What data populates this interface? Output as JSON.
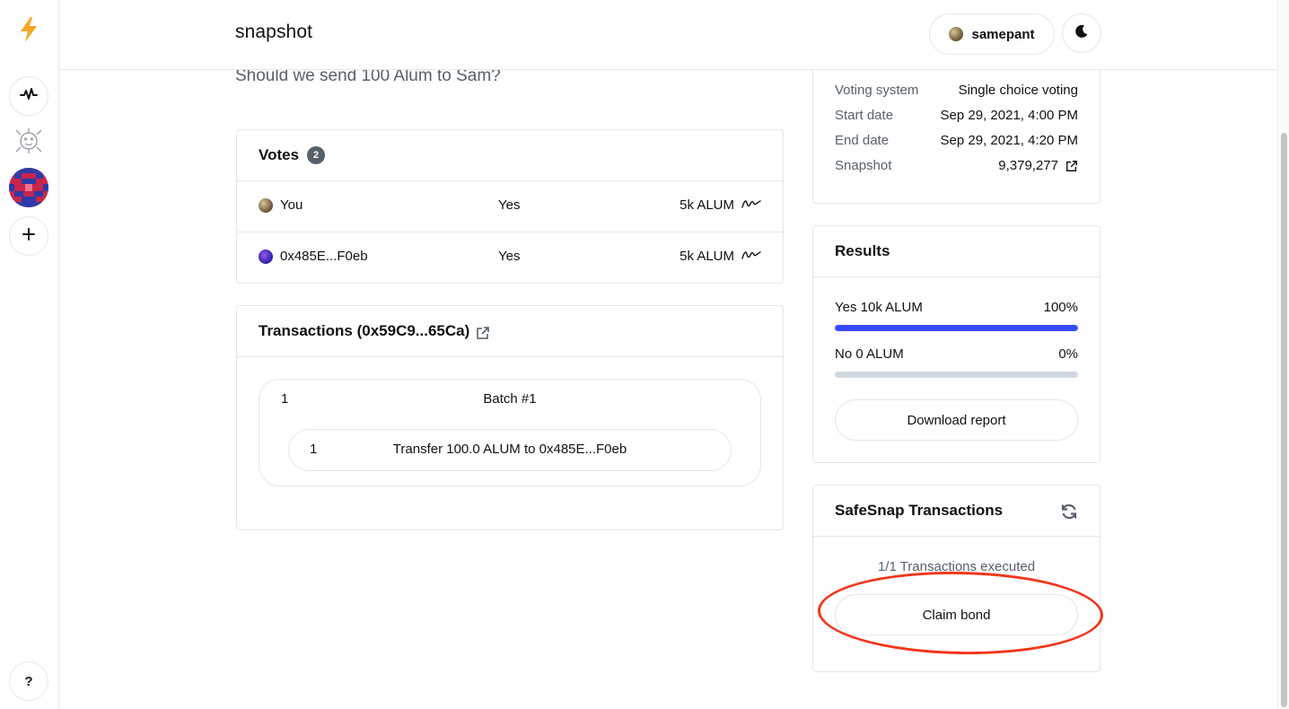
{
  "app": {
    "brand": "snapshot"
  },
  "sidebar": {
    "icons": [
      "lightning-icon",
      "activity-icon",
      "space-logo",
      "space-avatar",
      "plus-icon",
      "help-icon"
    ],
    "help_label": "?"
  },
  "header": {
    "username": "samepant"
  },
  "proposal": {
    "question": "Should we send 100 Alum to Sam?"
  },
  "votes": {
    "title": "Votes",
    "count": "2",
    "rows": [
      {
        "voter": "You",
        "choice": "Yes",
        "power": "5k ALUM"
      },
      {
        "voter": "0x485E...F0eb",
        "choice": "Yes",
        "power": "5k ALUM"
      }
    ]
  },
  "transactions": {
    "title": "Transactions (0x59C9...65Ca)",
    "batch_number": "1",
    "batch_title": "Batch #1",
    "tx_number": "1",
    "tx_description": "Transfer 100.0 ALUM to 0x485E...F0eb"
  },
  "information": {
    "rows": [
      {
        "label": "Voting system",
        "value": "Single choice voting"
      },
      {
        "label": "Start date",
        "value": "Sep 29, 2021, 4:00 PM"
      },
      {
        "label": "End date",
        "value": "Sep 29, 2021, 4:20 PM"
      },
      {
        "label": "Snapshot",
        "value": "9,379,277"
      }
    ]
  },
  "results": {
    "title": "Results",
    "items": [
      {
        "label": "Yes 10k ALUM",
        "percent": "100%",
        "fraction": 1.0,
        "color": "#384aff"
      },
      {
        "label": "No 0 ALUM",
        "percent": "0%",
        "fraction": 0.0,
        "color": "#384aff"
      }
    ],
    "download_label": "Download report"
  },
  "safesnap": {
    "title": "SafeSnap Transactions",
    "status": "1/1 Transactions executed",
    "claim_label": "Claim bond"
  },
  "colors": {
    "accent": "#384aff",
    "annotation": "#f2361b",
    "border": "#e3e6ea",
    "muted": "#57606a",
    "lightning": "#f5a623"
  }
}
